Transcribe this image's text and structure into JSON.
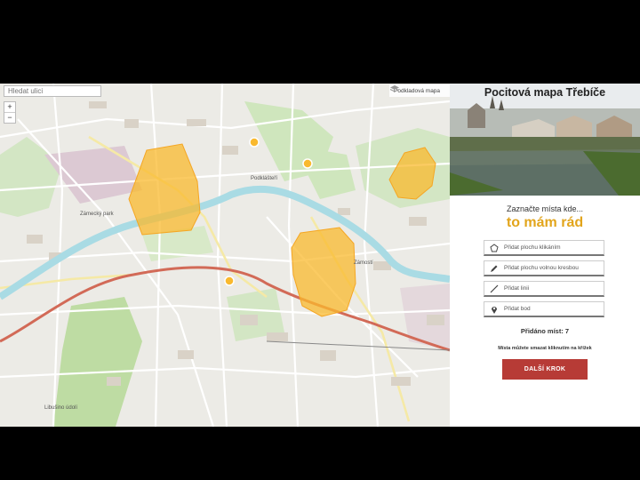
{
  "map": {
    "search_placeholder": "Hledat ulici",
    "zoom_in": "+",
    "zoom_out": "−",
    "layer_label": "Podkladová mapa",
    "labels": {
      "zamecky_park": "Zámecký park",
      "podklasteri": "Podklášteří",
      "zamost": "Zámostí",
      "lubne": "Libušino údolí"
    },
    "highlight_color": "#f9b92e",
    "river_color": "#a9dbe4",
    "rail_color": "#d26a57"
  },
  "panel": {
    "title": "Pocitová mapa Třebíče",
    "subhead": "Zaznačte místa kde...",
    "accent": "to mám rád",
    "accent_color": "#e2a51c",
    "tools": [
      {
        "icon": "pentagon-icon",
        "label": "Přidat plochu klikáním"
      },
      {
        "icon": "pencil-icon",
        "label": "Přidat plochu volnou kresbou"
      },
      {
        "icon": "line-icon",
        "label": "Přidat linii"
      },
      {
        "icon": "pin-icon",
        "label": "Přidat bod"
      }
    ],
    "count_text": "Přidáno míst: 7",
    "hint": "Místa můžete smazat kliknutím na křížek",
    "next_button": "DALŠÍ KROK",
    "button_color": "#b73b36"
  }
}
